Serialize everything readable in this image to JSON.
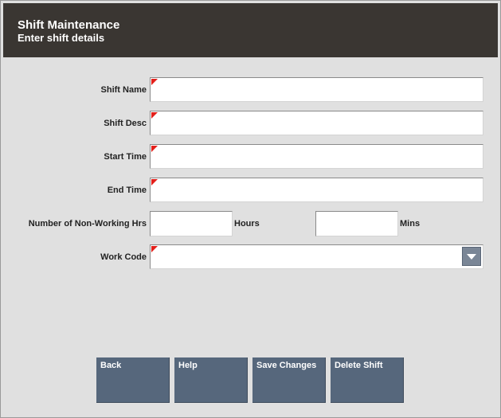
{
  "header": {
    "title": "Shift Maintenance",
    "subtitle": "Enter shift details"
  },
  "form": {
    "shift_name_label": "Shift Name",
    "shift_name_value": "",
    "shift_desc_label": "Shift Desc",
    "shift_desc_value": "",
    "start_time_label": "Start Time",
    "start_time_value": "",
    "end_time_label": "End Time",
    "end_time_value": "",
    "non_working_label": "Number of Non-Working Hrs",
    "hours_value": "",
    "hours_unit": "Hours",
    "mins_value": "",
    "mins_unit": "Mins",
    "work_code_label": "Work Code",
    "work_code_value": ""
  },
  "buttons": {
    "back": "Back",
    "help": "Help",
    "save_changes": "Save Changes",
    "delete_shift": "Delete Shift"
  },
  "colors": {
    "header_bg": "#3a3632",
    "body_bg": "#e0e0e0",
    "button_bg": "#56677c",
    "required_marker": "#e3201b"
  },
  "icons": {
    "required": "red-corner-triangle",
    "dropdown": "chevron-down-icon"
  }
}
